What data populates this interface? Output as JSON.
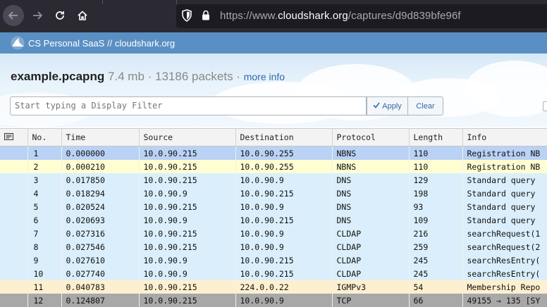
{
  "browser": {
    "url_prefix": "https://www.",
    "url_host": "cloudshark.org",
    "url_path": "/captures/d9d839bfe96f"
  },
  "header": {
    "title": "CS Personal SaaS // cloudshark.org"
  },
  "file": {
    "name": "example.pcapng",
    "meta": " 7.4 mb · 13186 packets · ",
    "more_info": "more info"
  },
  "filter": {
    "placeholder": "Start typing a Display Filter",
    "apply_label": "Apply",
    "clear_label": "Clear"
  },
  "table": {
    "columns": [
      "No.",
      "Time",
      "Source",
      "Destination",
      "Protocol",
      "Length",
      "Info"
    ],
    "rows": [
      {
        "no": "1",
        "time": "0.000000",
        "src": "10.0.90.215",
        "dst": "10.0.90.255",
        "proto": "NBNS",
        "len": "110",
        "info": "Registration NB"
      },
      {
        "no": "2",
        "time": "0.000210",
        "src": "10.0.90.215",
        "dst": "10.0.90.255",
        "proto": "NBNS",
        "len": "110",
        "info": "Registration NB"
      },
      {
        "no": "3",
        "time": "0.017850",
        "src": "10.0.90.215",
        "dst": "10.0.90.9",
        "proto": "DNS",
        "len": "129",
        "info": "Standard query"
      },
      {
        "no": "4",
        "time": "0.018294",
        "src": "10.0.90.9",
        "dst": "10.0.90.215",
        "proto": "DNS",
        "len": "198",
        "info": "Standard query"
      },
      {
        "no": "5",
        "time": "0.020524",
        "src": "10.0.90.215",
        "dst": "10.0.90.9",
        "proto": "DNS",
        "len": "93",
        "info": "Standard query"
      },
      {
        "no": "6",
        "time": "0.020693",
        "src": "10.0.90.9",
        "dst": "10.0.90.215",
        "proto": "DNS",
        "len": "109",
        "info": "Standard query"
      },
      {
        "no": "7",
        "time": "0.027316",
        "src": "10.0.90.215",
        "dst": "10.0.90.9",
        "proto": "CLDAP",
        "len": "216",
        "info": "searchRequest(1"
      },
      {
        "no": "8",
        "time": "0.027546",
        "src": "10.0.90.215",
        "dst": "10.0.90.9",
        "proto": "CLDAP",
        "len": "259",
        "info": "searchRequest(2"
      },
      {
        "no": "9",
        "time": "0.027610",
        "src": "10.0.90.9",
        "dst": "10.0.90.215",
        "proto": "CLDAP",
        "len": "245",
        "info": "searchResEntry("
      },
      {
        "no": "10",
        "time": "0.027740",
        "src": "10.0.90.9",
        "dst": "10.0.90.215",
        "proto": "CLDAP",
        "len": "245",
        "info": "searchResEntry("
      },
      {
        "no": "11",
        "time": "0.040783",
        "src": "10.0.90.215",
        "dst": "224.0.0.22",
        "proto": "IGMPv3",
        "len": "54",
        "info": "Membership Repo"
      },
      {
        "no": "12",
        "time": "0.124807",
        "src": "10.0.90.215",
        "dst": "10.0.90.9",
        "proto": "TCP",
        "len": "66",
        "info": "49155 → 135 [SY"
      }
    ]
  },
  "colors": {
    "header_bg": "#5a8fc3",
    "selected_row": "#b9d2f5",
    "nbns_row": "#fefed2",
    "udp_row": "#daeffb",
    "igmp_row": "#fdf0cf",
    "tcp_row": "#a8a8a8",
    "link": "#2f6aa8"
  },
  "icons": [
    "back-arrow-icon",
    "forward-arrow-icon",
    "reload-icon",
    "home-icon",
    "shield-icon",
    "lock-icon",
    "shark-logo-icon",
    "checkmark-icon",
    "packet-list-icon"
  ]
}
